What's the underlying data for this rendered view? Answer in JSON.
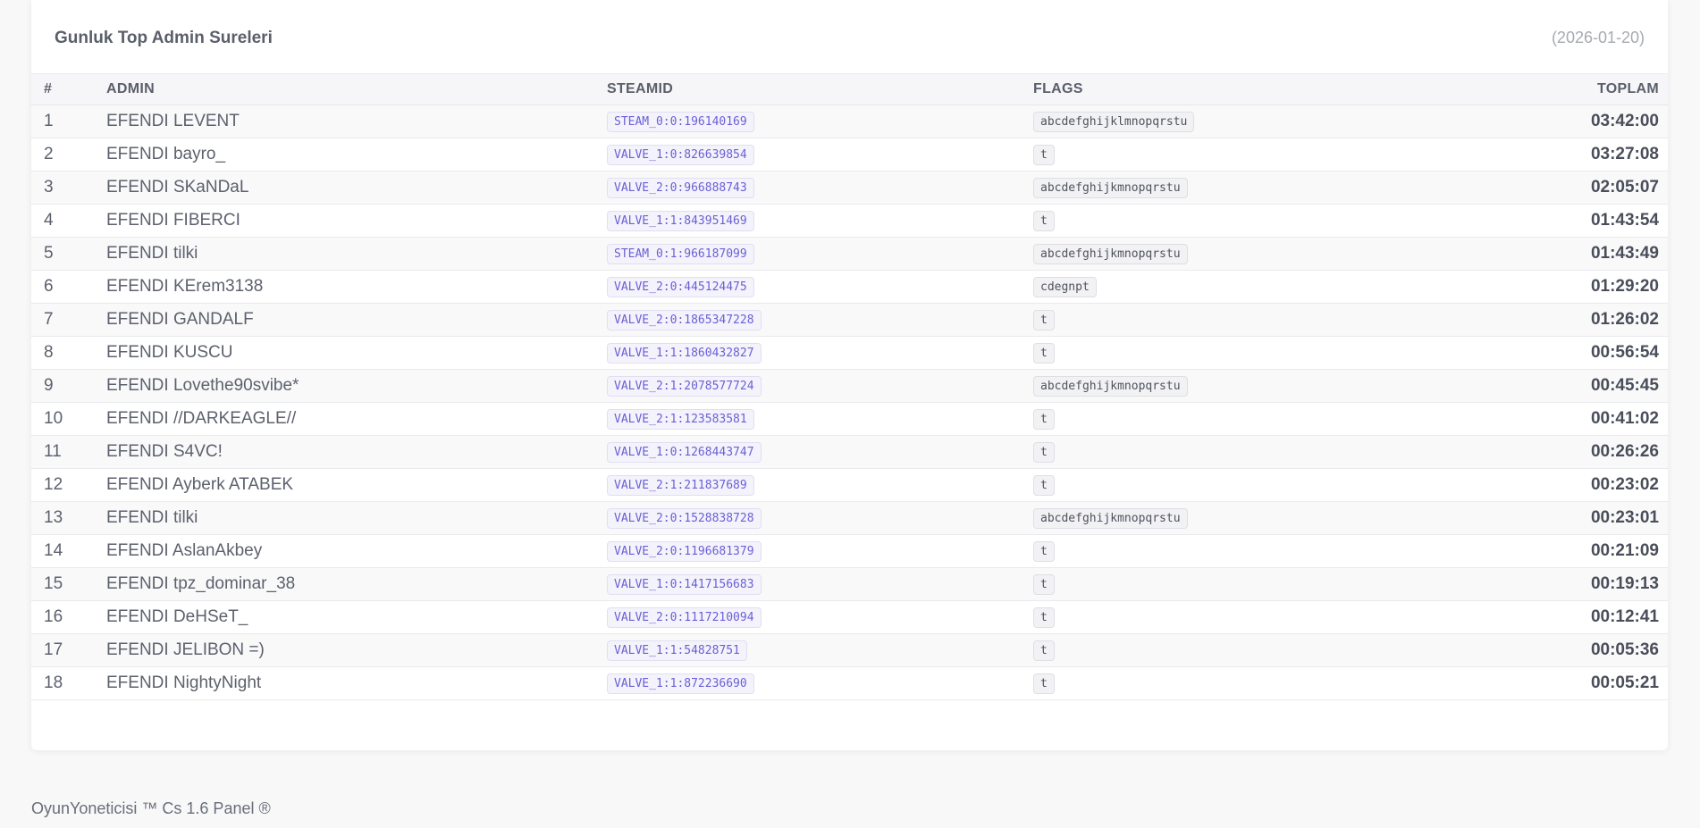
{
  "card": {
    "title": "Gunluk Top Admin Sureleri",
    "date": "(2026-01-20)"
  },
  "table": {
    "headers": {
      "num": "#",
      "admin": "ADMIN",
      "steamid": "STEAMID",
      "flags": "FLAGS",
      "total": "TOPLAM"
    },
    "rows": [
      {
        "num": "1",
        "admin": "EFENDI LEVENT",
        "steamid": "STEAM_0:0:196140169",
        "flags": "abcdefghijklmnopqrstu",
        "total": "03:42:00"
      },
      {
        "num": "2",
        "admin": "EFENDI bayro_",
        "steamid": "VALVE_1:0:826639854",
        "flags": "t",
        "total": "03:27:08"
      },
      {
        "num": "3",
        "admin": "EFENDI SKaNDaL",
        "steamid": "VALVE_2:0:966888743",
        "flags": "abcdefghijkmnopqrstu",
        "total": "02:05:07"
      },
      {
        "num": "4",
        "admin": "EFENDI FIBERCI",
        "steamid": "VALVE_1:1:843951469",
        "flags": "t",
        "total": "01:43:54"
      },
      {
        "num": "5",
        "admin": "EFENDI tilki",
        "steamid": "STEAM_0:1:966187099",
        "flags": "abcdefghijkmnopqrstu",
        "total": "01:43:49"
      },
      {
        "num": "6",
        "admin": "EFENDI KErem3138",
        "steamid": "VALVE_2:0:445124475",
        "flags": "cdegnpt",
        "total": "01:29:20"
      },
      {
        "num": "7",
        "admin": "EFENDI GANDALF",
        "steamid": "VALVE_2:0:1865347228",
        "flags": "t",
        "total": "01:26:02"
      },
      {
        "num": "8",
        "admin": "EFENDI KUSCU",
        "steamid": "VALVE_1:1:1860432827",
        "flags": "t",
        "total": "00:56:54"
      },
      {
        "num": "9",
        "admin": "EFENDI Lovethe90svibe*",
        "steamid": "VALVE_2:1:2078577724",
        "flags": "abcdefghijkmnopqrstu",
        "total": "00:45:45"
      },
      {
        "num": "10",
        "admin": "EFENDI //DARKEAGLE//",
        "steamid": "VALVE_2:1:123583581",
        "flags": "t",
        "total": "00:41:02"
      },
      {
        "num": "11",
        "admin": "EFENDI S4VC!",
        "steamid": "VALVE_1:0:1268443747",
        "flags": "t",
        "total": "00:26:26"
      },
      {
        "num": "12",
        "admin": "EFENDI Ayberk ATABEK",
        "steamid": "VALVE_2:1:211837689",
        "flags": "t",
        "total": "00:23:02"
      },
      {
        "num": "13",
        "admin": "EFENDI tilki",
        "steamid": "VALVE_2:0:1528838728",
        "flags": "abcdefghijkmnopqrstu",
        "total": "00:23:01"
      },
      {
        "num": "14",
        "admin": "EFENDI AslanAkbey",
        "steamid": "VALVE_2:0:1196681379",
        "flags": "t",
        "total": "00:21:09"
      },
      {
        "num": "15",
        "admin": "EFENDI tpz_dominar_38",
        "steamid": "VALVE_1:0:1417156683",
        "flags": "t",
        "total": "00:19:13"
      },
      {
        "num": "16",
        "admin": "EFENDI DeHSeT_",
        "steamid": "VALVE_2:0:1117210094",
        "flags": "t",
        "total": "00:12:41"
      },
      {
        "num": "17",
        "admin": "EFENDI JELIBON =)",
        "steamid": "VALVE_1:1:54828751",
        "flags": "t",
        "total": "00:05:36"
      },
      {
        "num": "18",
        "admin": "EFENDI NightyNight",
        "steamid": "VALVE_1:1:872236690",
        "flags": "t",
        "total": "00:05:21"
      }
    ]
  },
  "footer": {
    "text": "OyunYoneticisi ™ Cs 1.6 Panel ®"
  }
}
